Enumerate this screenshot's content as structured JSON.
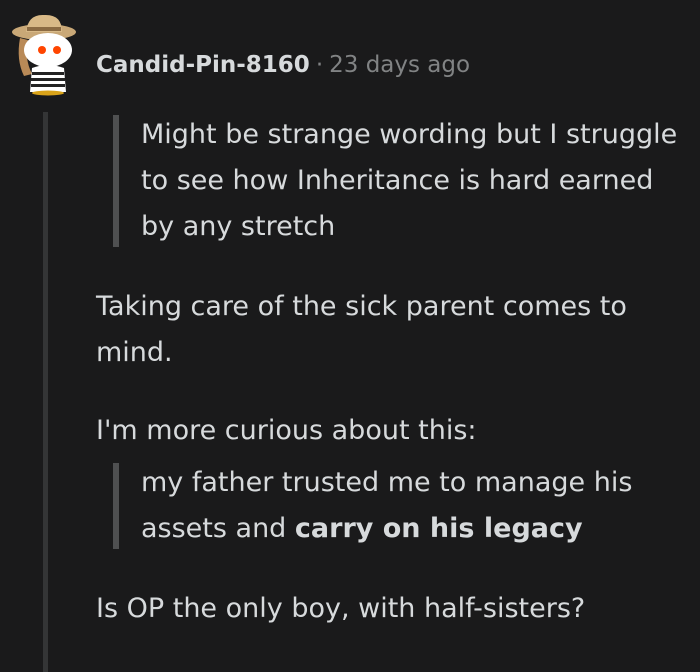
{
  "comment": {
    "username": "Candid-Pin-8160",
    "separator": "·",
    "timestamp": "23 days ago",
    "quote1": "Might be strange wording but I struggle to see how Inheritance is hard earned by any stretch",
    "paragraph1": "Taking care of the sick parent comes to mind.",
    "paragraph2": "I'm more curious about this:",
    "quote2_plain": "my father trusted me to manage his assets and ",
    "quote2_bold": "carry on his legacy",
    "paragraph3": "Is OP the only boy, with half-sisters?"
  },
  "avatar": {
    "icon": "reddit-snoo-avatar-icon",
    "hat_color": "#c9a877",
    "eye_color": "#ff4500"
  },
  "colors": {
    "background": "#1a1a1b",
    "text": "#d7dadc",
    "meta": "#818384",
    "quote_bar": "#4f5051",
    "thread_line": "#343536"
  }
}
